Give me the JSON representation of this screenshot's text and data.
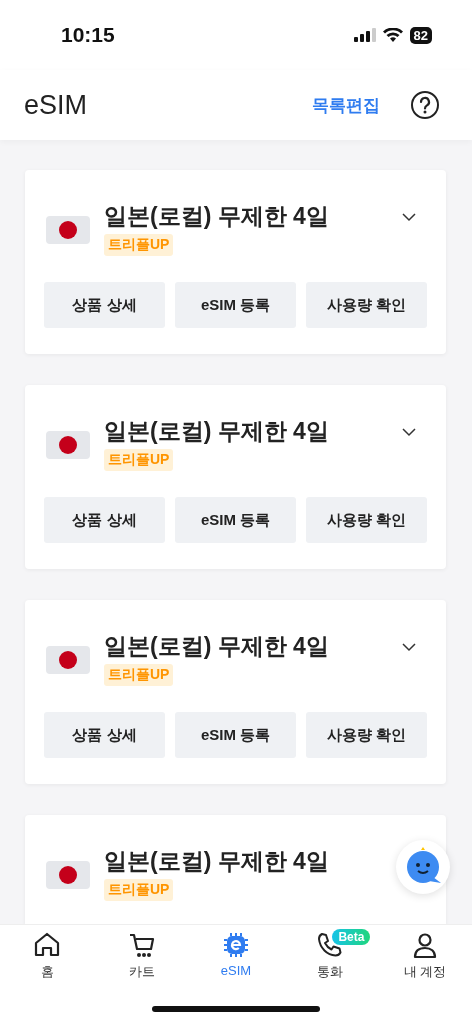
{
  "status_bar": {
    "time": "10:15",
    "battery": "82"
  },
  "header": {
    "title": "eSIM",
    "edit_link": "목록편집"
  },
  "cards": [
    {
      "title": "일본(로컬) 무제한 4일",
      "badge": "트리플UP",
      "expanded": false,
      "buttons": [
        "상품 상세",
        "eSIM 등록",
        "사용량 확인"
      ]
    },
    {
      "title": "일본(로컬) 무제한 4일",
      "badge": "트리플UP",
      "expanded": false,
      "buttons": [
        "상품 상세",
        "eSIM 등록",
        "사용량 확인"
      ]
    },
    {
      "title": "일본(로컬) 무제한 4일",
      "badge": "트리플UP",
      "expanded": false,
      "buttons": [
        "상품 상세",
        "eSIM 등록",
        "사용량 확인"
      ]
    },
    {
      "title": "일본(로컬) 무제한 4일",
      "badge": "트리플UP"
    }
  ],
  "tabs": [
    {
      "kind": "home",
      "label": "홈",
      "selected": false
    },
    {
      "kind": "cart",
      "label": "카트",
      "selected": false
    },
    {
      "kind": "esim",
      "label": "eSIM",
      "selected": true
    },
    {
      "kind": "call",
      "label": "통화",
      "selected": false,
      "badge": "Beta"
    },
    {
      "kind": "account",
      "label": "내 계정",
      "selected": false
    }
  ]
}
